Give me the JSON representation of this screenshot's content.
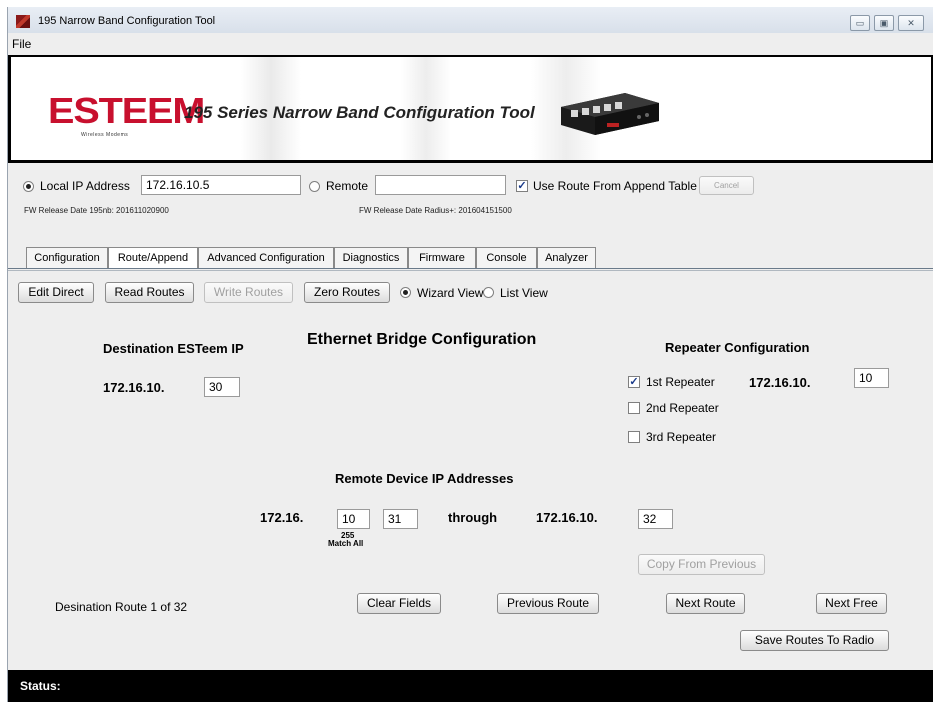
{
  "window": {
    "title": "195 Narrow Band Configuration Tool",
    "buttons": {
      "minimize": "▭",
      "maximize": "▣",
      "close": "✕"
    }
  },
  "menu": {
    "file": "File"
  },
  "banner": {
    "logo": "ESTEEM",
    "logo_sub": "Wireless Modems",
    "title": "195 Series Narrow Band Configuration Tool"
  },
  "connection": {
    "local_label": "Local IP Address",
    "local_ip": "172.16.10.5",
    "local_selected": true,
    "remote_label": "Remote",
    "remote_value": "",
    "remote_selected": false,
    "use_route_label": "Use Route From Append Table",
    "use_route_checked": true,
    "cancel_label": "Cancel",
    "fw_195nb": "FW Release Date 195nb: 201611020900",
    "fw_radius": "FW Release Date Radius+: 201604151500"
  },
  "tabs": [
    {
      "label": "Configuration",
      "active": false
    },
    {
      "label": "Route/Append",
      "active": true
    },
    {
      "label": "Advanced Configuration",
      "active": false
    },
    {
      "label": "Diagnostics",
      "active": false
    },
    {
      "label": "Firmware",
      "active": false
    },
    {
      "label": "Console",
      "active": false
    },
    {
      "label": "Analyzer",
      "active": false
    }
  ],
  "toolbar": {
    "edit_direct": "Edit Direct",
    "read_routes": "Read Routes",
    "write_routes": "Write Routes",
    "zero_routes": "Zero Routes",
    "wizard_view": "Wizard View",
    "list_view": "List View"
  },
  "bridge": {
    "title": "Ethernet Bridge Configuration",
    "dest_heading": "Destination ESTeem IP",
    "dest_prefix": "172.16.10.",
    "dest_value": "30"
  },
  "repeater": {
    "heading": "Repeater Configuration",
    "first_label": "1st Repeater",
    "first_checked": true,
    "first_prefix": "172.16.10.",
    "first_value": "10",
    "second_label": "2nd Repeater",
    "second_checked": false,
    "third_label": "3rd Repeater",
    "third_checked": false
  },
  "remote_devices": {
    "heading": "Remote Device IP Addresses",
    "prefix": "172.16.",
    "octet3": "10",
    "octet4_start": "31",
    "through_label": "through",
    "end_prefix": "172.16.10.",
    "octet4_end": "32",
    "hint_value": "255",
    "hint_label": "Match All",
    "copy_previous": "Copy From Previous"
  },
  "navigation": {
    "route_info": "Desination Route 1 of 32",
    "clear_fields": "Clear Fields",
    "previous_route": "Previous Route",
    "next_route": "Next Route",
    "next_free": "Next Free",
    "save_routes": "Save Routes To Radio"
  },
  "status": {
    "label": "Status:"
  },
  "colors": {
    "logo_red": "#c8102e",
    "status_bg": "#000000"
  }
}
